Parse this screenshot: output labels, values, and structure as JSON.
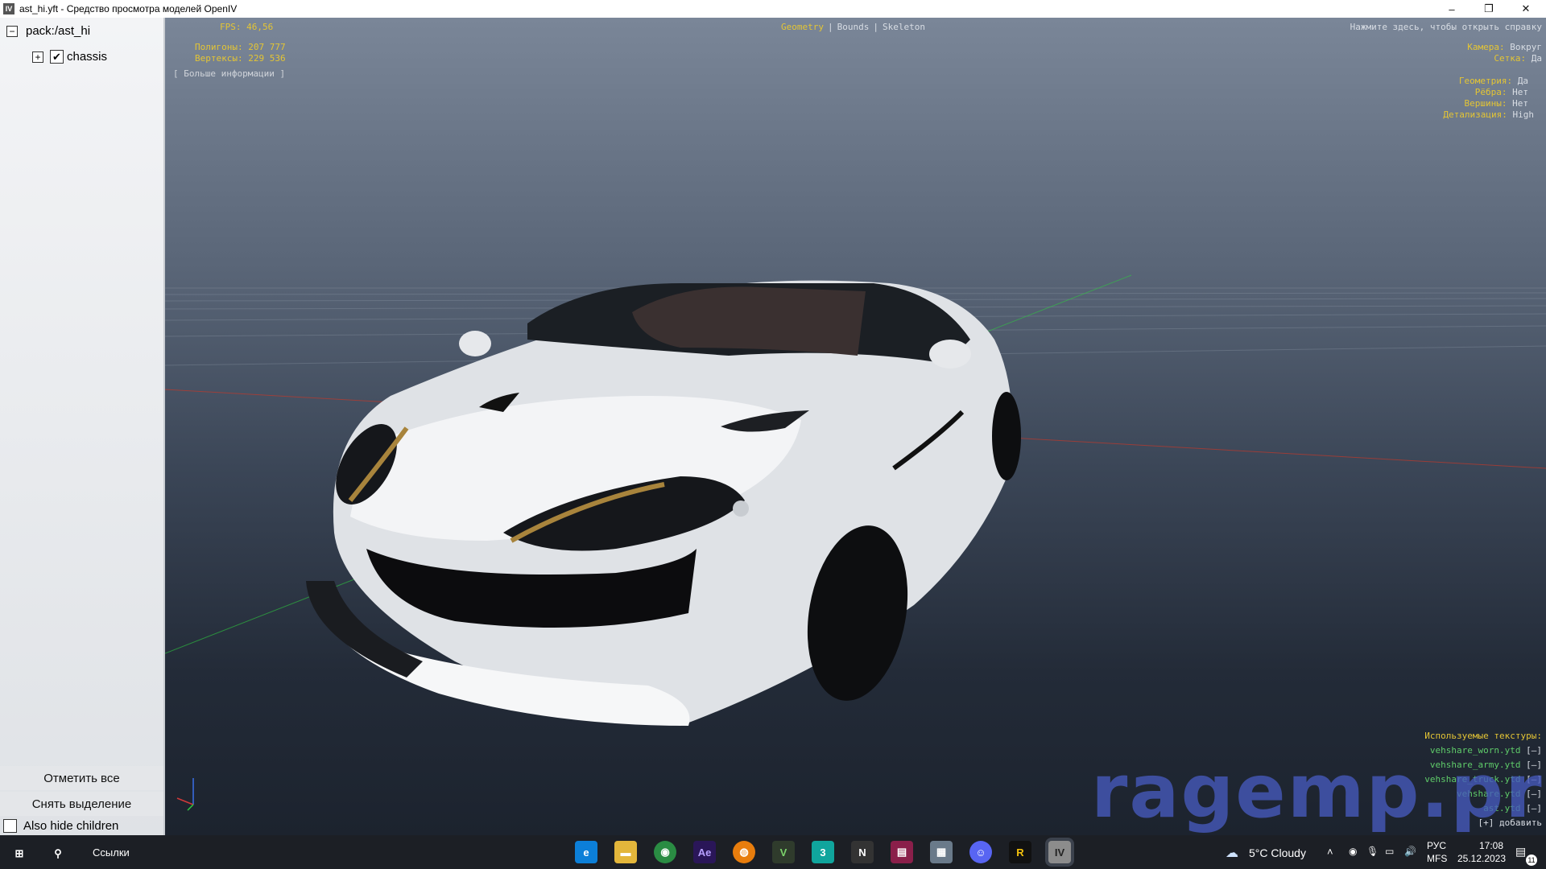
{
  "window": {
    "title": "ast_hi.yft - Средство просмотра моделей OpenIV",
    "icon": "openiv-icon"
  },
  "window_controls": {
    "minimize": "–",
    "restore": "❐",
    "close": "✕"
  },
  "tree": {
    "root_label": "pack:/ast_hi",
    "child_label": "chassis"
  },
  "left_buttons": {
    "select_all": "Отметить все",
    "deselect": "Снять выделение",
    "also_hide": "Also hide children"
  },
  "hud": {
    "fps": "FPS: 46,56",
    "polygons": "Полигоны: 207 777",
    "vertices": "Вертексы: 229 536",
    "more_info": "[ Больше информации ]",
    "mode_geometry": "Geometry",
    "sep1": "|",
    "mode_bounds": "Bounds",
    "sep2": "|",
    "mode_skeleton": "Skeleton",
    "help": "Нажмите здесь, чтобы открыть справку",
    "camera_label": "Камера:",
    "camera_value": "Вокруг",
    "grid_label": "Сетка:",
    "grid_value": "Да",
    "geometry_label": "Геометрия:",
    "geometry_value": "Да",
    "edges_label": "Рёбра:",
    "edges_value": "Нет",
    "vertices_label": "Вершины:",
    "vertices_value": "Нет",
    "detail_label": "Детализация:",
    "detail_value": "High",
    "textures_title": "Используемые текстуры:",
    "textures": [
      {
        "name": "vehshare_worn.ytd",
        "btn": "[–]"
      },
      {
        "name": "vehshare_army.ytd",
        "btn": "[–]"
      },
      {
        "name": "vehshare_truck.ytd",
        "btn": "[–]"
      },
      {
        "name": "vehshare.ytd",
        "btn": "[–]"
      },
      {
        "name": "ast.ytd",
        "btn": "[–]"
      }
    ],
    "add": "[+] добавить"
  },
  "watermark": "ragemp.pro",
  "taskbar": {
    "links": "Ссылки",
    "weather": "5°C  Cloudy",
    "lang1": "РУС",
    "lang2": "MFS",
    "time": "17:08",
    "date": "25.12.2023",
    "notif": "11",
    "apps": [
      "edge-icon",
      "file-explorer-icon",
      "chrome-icon",
      "after-effects-icon",
      "blender-icon",
      "vegas-icon",
      "3dsmax-icon",
      "nvidia-icon",
      "winrar-icon",
      "photos-icon",
      "discord-icon",
      "rockstar-icon",
      "openiv-icon"
    ]
  },
  "colors": {
    "hud_yellow": "#e4c534",
    "hud_green": "#5fcc6a",
    "taskbar": "#1c1f25"
  }
}
